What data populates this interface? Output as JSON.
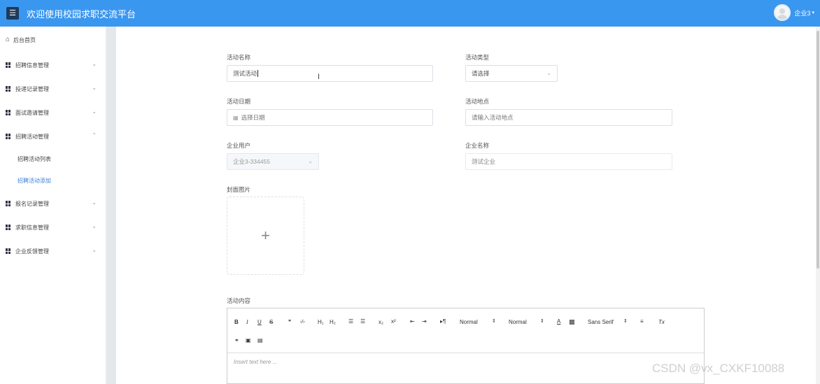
{
  "header": {
    "menu_icon": "hamburger-icon",
    "title": "欢迎使用校园求职交流平台",
    "user_name": "企业3",
    "caret": "▾"
  },
  "sidebar": {
    "home": "后台首页",
    "items": [
      {
        "label": "招聘信息管理",
        "arrow": "⌄"
      },
      {
        "label": "投递记录管理",
        "arrow": "⌄"
      },
      {
        "label": "面试邀请管理",
        "arrow": "⌄"
      },
      {
        "label": "招聘活动管理",
        "arrow": "⌃"
      },
      {
        "label": "报名记录管理",
        "arrow": "⌄"
      },
      {
        "label": "求职信息管理",
        "arrow": "⌄"
      },
      {
        "label": "企业反馈管理",
        "arrow": "⌄"
      }
    ],
    "sub_items": [
      {
        "label": "招聘活动列表"
      },
      {
        "label": "招聘活动添加"
      }
    ]
  },
  "form": {
    "activity_name": {
      "label": "活动名称",
      "value": "测试活动"
    },
    "activity_type": {
      "label": "活动类型",
      "placeholder": "请选择"
    },
    "activity_date": {
      "label": "活动日期",
      "placeholder": "选择日期"
    },
    "activity_location": {
      "label": "活动地点",
      "placeholder": "请输入活动地点"
    },
    "company_user": {
      "label": "企业用户",
      "value": "企业3-334455"
    },
    "company_name": {
      "label": "企业名称",
      "value": "测试企业"
    },
    "cover_image": {
      "label": "封面图片",
      "plus": "+"
    },
    "content": {
      "label": "活动内容",
      "placeholder": "Insert text here ..."
    }
  },
  "toolbar": {
    "bold": "B",
    "italic": "I",
    "underline": "U",
    "strike": "S",
    "blockquote": "❞",
    "code": "‹/›",
    "h1": "H₁",
    "h2": "H₂",
    "x_sub": "x₂",
    "x_sup": "x²",
    "size_select": "Normal",
    "header_select": "Normal",
    "font_select": "Sans Serif",
    "clean": "Tx"
  },
  "watermark": "CSDN @vx_CXKF10088"
}
